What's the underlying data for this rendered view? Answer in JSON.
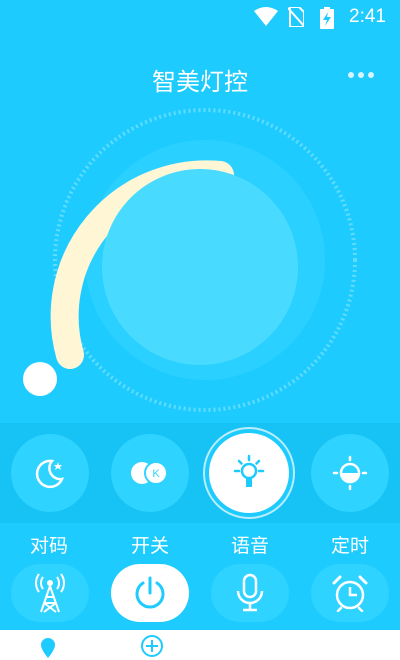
{
  "status_bar": {
    "time": "2:41"
  },
  "header": {
    "title": "智美灯控"
  },
  "dial": {
    "level": 0.62
  },
  "modes": [
    {
      "name": "night",
      "icon": "moon-icon"
    },
    {
      "name": "color-temperature",
      "icon": "k-icon"
    },
    {
      "name": "light",
      "icon": "bulb-icon"
    },
    {
      "name": "brightness",
      "icon": "half-sun-icon"
    }
  ],
  "functions": [
    {
      "label": "对码",
      "icon": "signal-tower-icon"
    },
    {
      "label": "开关",
      "icon": "power-icon"
    },
    {
      "label": "语音",
      "icon": "microphone-icon"
    },
    {
      "label": "定时",
      "icon": "alarm-clock-icon"
    }
  ],
  "colors": {
    "background": "#1ecbff",
    "button": "#2ed3ff",
    "arc": "#fff6d6"
  }
}
